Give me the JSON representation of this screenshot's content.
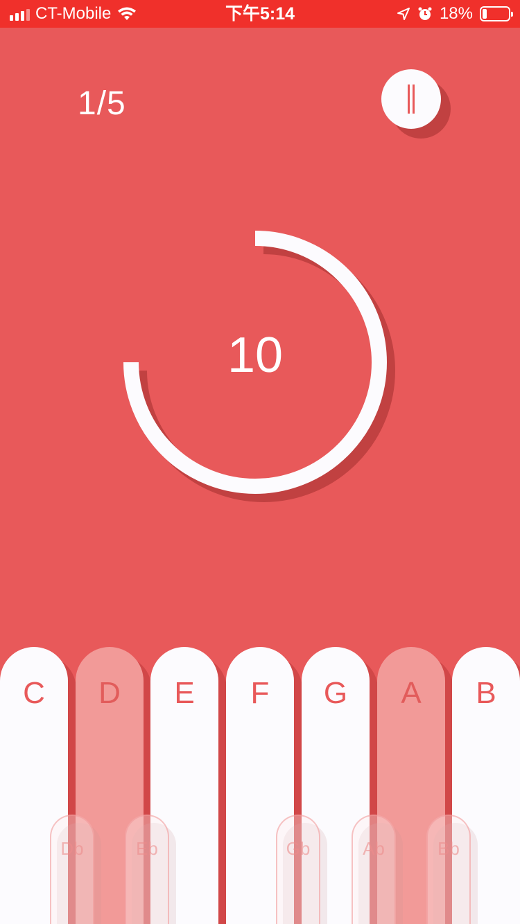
{
  "status_bar": {
    "carrier": "CT-Mobile",
    "time": "下午5:14",
    "battery_text": "18%",
    "battery_level": 0.18,
    "icons": [
      "signal-icon",
      "wifi-icon",
      "location-icon",
      "alarm-icon",
      "battery-icon"
    ]
  },
  "session": {
    "progress": "1/5",
    "countdown": "10",
    "timer_remaining_fraction": 0.75
  },
  "keyboard": {
    "natural_keys": [
      {
        "label": "C",
        "active": false
      },
      {
        "label": "D",
        "active": true
      },
      {
        "label": "E",
        "active": false
      },
      {
        "label": "F",
        "active": false
      },
      {
        "label": "G",
        "active": false
      },
      {
        "label": "A",
        "active": true
      },
      {
        "label": "B",
        "active": false
      }
    ],
    "flat_keys": [
      "Db",
      "Eb",
      "Gb",
      "Ab",
      "Bb"
    ]
  },
  "colors": {
    "background": "#E8595A",
    "status_bar": "#F0302B",
    "key": "#FCFBFE",
    "key_active": "#F29A98",
    "accent_text": "#E8595A"
  }
}
